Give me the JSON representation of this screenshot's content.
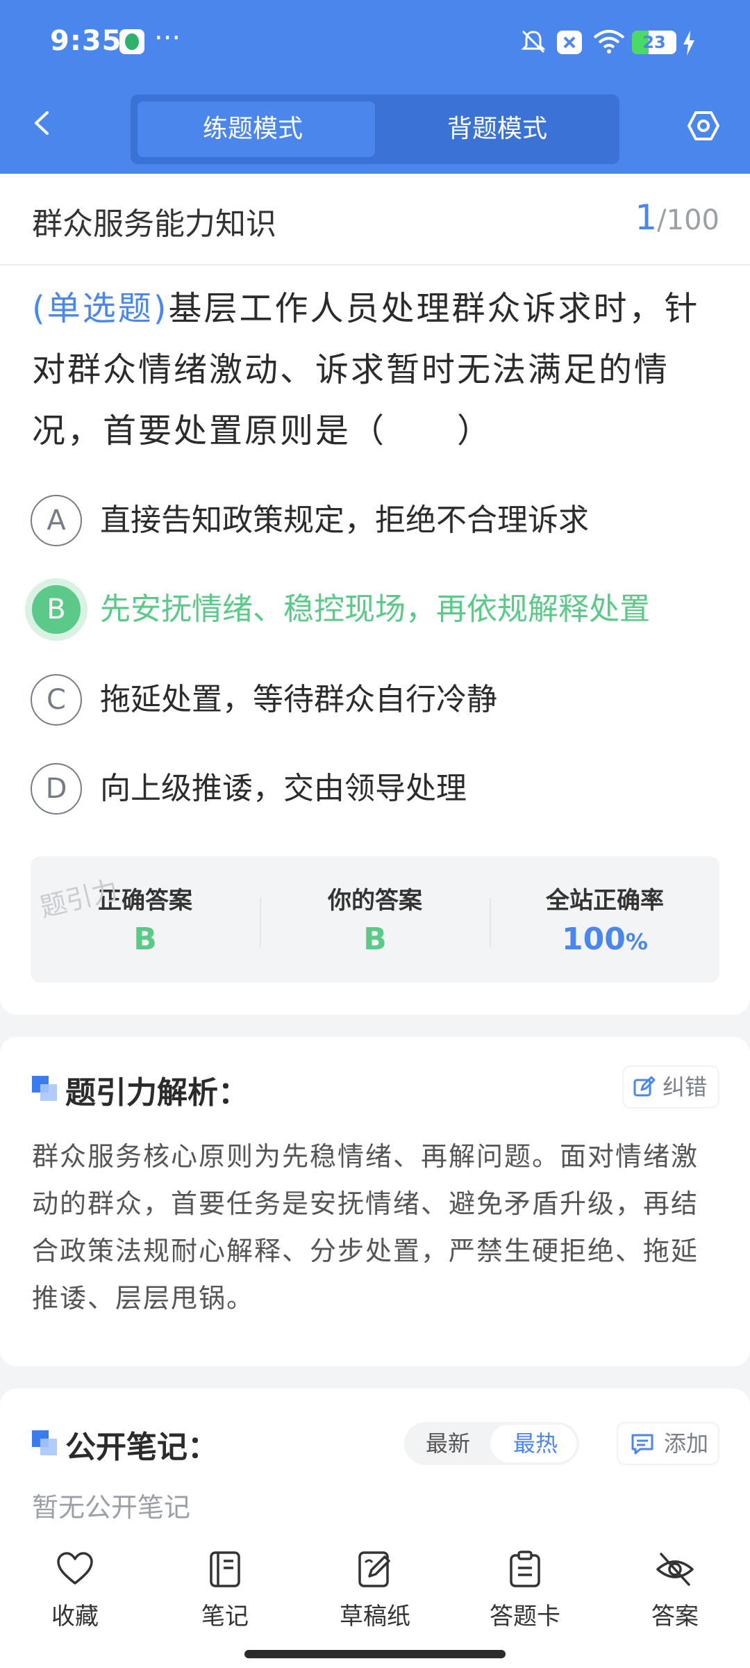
{
  "status_bar": {
    "time": "9:35",
    "dots": "···",
    "battery": "23"
  },
  "header": {
    "tabs": [
      {
        "label": "练题模式",
        "active": true
      },
      {
        "label": "背题模式",
        "active": false
      }
    ]
  },
  "question": {
    "category": "群众服务能力知识",
    "index": "1",
    "total": "/100",
    "type": "(单选题)",
    "text": "基层工作人员处理群众诉求时，针对群众情绪激动、诉求暂时无法满足的情况，首要处置原则是（　　）",
    "options": [
      {
        "letter": "A",
        "text": "直接告知政策规定，拒绝不合理诉求",
        "selected": false
      },
      {
        "letter": "B",
        "text": "先安抚情绪、稳控现场，再依规解释处置",
        "selected": true
      },
      {
        "letter": "C",
        "text": "拖延处置，等待群众自行冷静",
        "selected": false
      },
      {
        "letter": "D",
        "text": "向上级推诿，交由领导处理",
        "selected": false
      }
    ]
  },
  "answer_summary": {
    "watermark": "题引力",
    "correct_label": "正确答案",
    "correct_value": "B",
    "yours_label": "你的答案",
    "yours_value": "B",
    "rate_label": "全站正确率",
    "rate_value": "100",
    "rate_unit": "%"
  },
  "analysis": {
    "title": "题引力解析：",
    "report_label": "纠错",
    "text": "群众服务核心原则为先稳情绪、再解问题。面对情绪激动的群众，首要任务是安抚情绪、避免矛盾升级，再结合政策法规耐心解释、分步处置，严禁生硬拒绝、拖延推诿、层层甩锅。"
  },
  "notes": {
    "title": "公开笔记：",
    "sort_latest": "最新",
    "sort_hot": "最热",
    "add_label": "添加",
    "empty_text": "暂无公开笔记"
  },
  "bottom_bar": [
    {
      "label": "收藏",
      "icon": "heart-icon"
    },
    {
      "label": "笔记",
      "icon": "notebook-icon"
    },
    {
      "label": "草稿纸",
      "icon": "draft-icon"
    },
    {
      "label": "答题卡",
      "icon": "answer-card-icon"
    },
    {
      "label": "答案",
      "icon": "eye-off-icon"
    }
  ],
  "colors": {
    "primary": "#4a86ec",
    "correct": "#5bc987"
  }
}
